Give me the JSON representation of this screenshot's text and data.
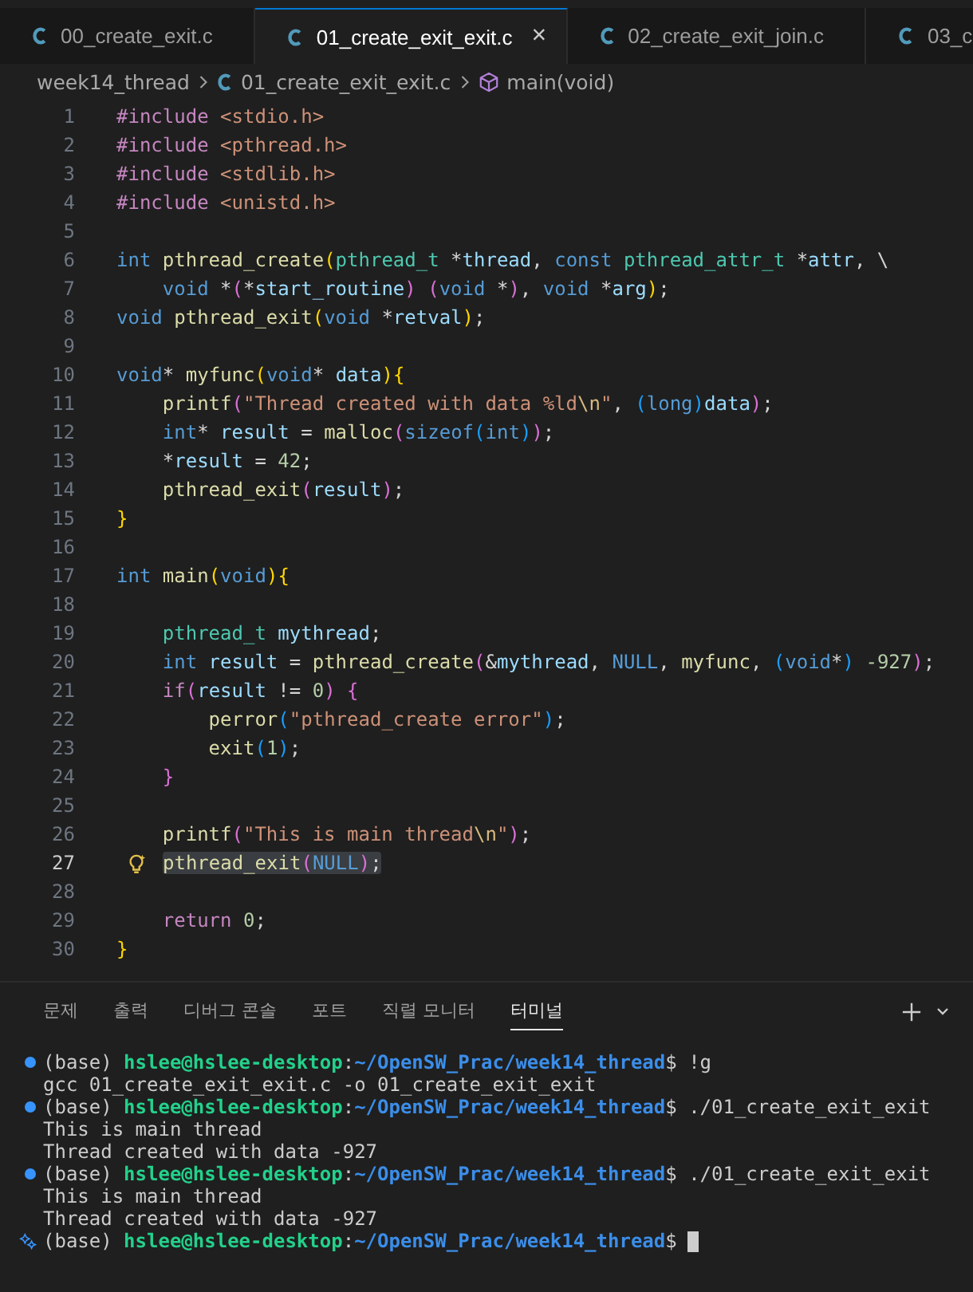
{
  "tabs": [
    {
      "label": "00_create_exit.c",
      "selected": false
    },
    {
      "label": "01_create_exit_exit.c",
      "selected": true,
      "close": "×"
    },
    {
      "label": "02_create_exit_join.c",
      "selected": false
    },
    {
      "label": "03_c",
      "selected": false
    }
  ],
  "breadcrumb": {
    "folder": "week14_thread",
    "file": "01_create_exit_exit.c",
    "symbol": "main(void)"
  },
  "code": [
    {
      "number": "1",
      "current": false,
      "tokens": [
        {
          "kind": "pre",
          "text": "#include"
        },
        {
          "kind": "hdr",
          "text": " <stdio.h>"
        }
      ]
    },
    {
      "number": "2",
      "current": false,
      "tokens": [
        {
          "kind": "pre",
          "text": "#include"
        },
        {
          "kind": "hdr",
          "text": " <pthread.h>"
        }
      ]
    },
    {
      "number": "3",
      "current": false,
      "tokens": [
        {
          "kind": "pre",
          "text": "#include"
        },
        {
          "kind": "hdr",
          "text": " <stdlib.h>"
        }
      ]
    },
    {
      "number": "4",
      "current": false,
      "tokens": [
        {
          "kind": "pre",
          "text": "#include"
        },
        {
          "kind": "hdr",
          "text": " <unistd.h>"
        }
      ]
    },
    {
      "number": "5",
      "current": false
    },
    {
      "number": "6",
      "current": false,
      "tokens": [
        {
          "kind": "kw",
          "text": "int"
        },
        {
          "kind": "fn",
          "text": " pthread_create"
        },
        {
          "kind": "b1",
          "text": "("
        },
        {
          "kind": "type",
          "text": "pthread_t"
        },
        {
          "kind": "p",
          "text": " *"
        },
        {
          "kind": "var",
          "text": "thread"
        },
        {
          "kind": "p",
          "text": ", "
        },
        {
          "kind": "kw",
          "text": "const"
        },
        {
          "kind": "type",
          "text": " pthread_attr_t"
        },
        {
          "kind": "p",
          "text": " *"
        },
        {
          "kind": "var",
          "text": "attr"
        },
        {
          "kind": "p",
          "text": ", \\"
        }
      ]
    },
    {
      "number": "7",
      "current": false,
      "tokens": [
        {
          "kind": "kw",
          "text": "    void"
        },
        {
          "kind": "p",
          "text": " *"
        },
        {
          "kind": "b2",
          "text": "("
        },
        {
          "kind": "p",
          "text": "*"
        },
        {
          "kind": "var",
          "text": "start_routine"
        },
        {
          "kind": "b2",
          "text": ")"
        },
        {
          "kind": "b2",
          "text": " ("
        },
        {
          "kind": "kw",
          "text": "void"
        },
        {
          "kind": "p",
          "text": " *"
        },
        {
          "kind": "b2",
          "text": ")"
        },
        {
          "kind": "p",
          "text": ","
        },
        {
          "kind": "kw",
          "text": " void"
        },
        {
          "kind": "p",
          "text": " *"
        },
        {
          "kind": "var",
          "text": "arg"
        },
        {
          "kind": "b1",
          "text": ")"
        },
        {
          "kind": "p",
          "text": ";"
        }
      ]
    },
    {
      "number": "8",
      "current": false,
      "tokens": [
        {
          "kind": "kw",
          "text": "void"
        },
        {
          "kind": "fn",
          "text": " pthread_exit"
        },
        {
          "kind": "b1",
          "text": "("
        },
        {
          "kind": "kw",
          "text": "void"
        },
        {
          "kind": "p",
          "text": " *"
        },
        {
          "kind": "var",
          "text": "retval"
        },
        {
          "kind": "b1",
          "text": ")"
        },
        {
          "kind": "p",
          "text": ";"
        }
      ]
    },
    {
      "number": "9",
      "current": false
    },
    {
      "number": "10",
      "current": false,
      "tokens": [
        {
          "kind": "kw",
          "text": "void"
        },
        {
          "kind": "p",
          "text": "*"
        },
        {
          "kind": "fn",
          "text": " myfunc"
        },
        {
          "kind": "b1",
          "text": "("
        },
        {
          "kind": "kw",
          "text": "void"
        },
        {
          "kind": "p",
          "text": "*"
        },
        {
          "kind": "var",
          "text": " data"
        },
        {
          "kind": "b1",
          "text": ")"
        },
        {
          "kind": "b1",
          "text": "{"
        }
      ]
    },
    {
      "number": "11",
      "current": false,
      "tokens": [
        {
          "kind": "fn",
          "text": "    printf"
        },
        {
          "kind": "b2",
          "text": "("
        },
        {
          "kind": "str",
          "text": "\"Thread created with data %ld"
        },
        {
          "kind": "esc",
          "text": "\\n"
        },
        {
          "kind": "str",
          "text": "\""
        },
        {
          "kind": "p",
          "text": ","
        },
        {
          "kind": "b3",
          "text": " ("
        },
        {
          "kind": "kw",
          "text": "long"
        },
        {
          "kind": "b3",
          "text": ")"
        },
        {
          "kind": "var",
          "text": "data"
        },
        {
          "kind": "b2",
          "text": ")"
        },
        {
          "kind": "p",
          "text": ";"
        }
      ]
    },
    {
      "number": "12",
      "current": false,
      "tokens": [
        {
          "kind": "kw",
          "text": "    int"
        },
        {
          "kind": "p",
          "text": "*"
        },
        {
          "kind": "var",
          "text": " result"
        },
        {
          "kind": "p",
          "text": " = "
        },
        {
          "kind": "fn",
          "text": "malloc"
        },
        {
          "kind": "b2",
          "text": "("
        },
        {
          "kind": "kw",
          "text": "sizeof"
        },
        {
          "kind": "b3",
          "text": "("
        },
        {
          "kind": "kw",
          "text": "int"
        },
        {
          "kind": "b3",
          "text": ")"
        },
        {
          "kind": "b2",
          "text": ")"
        },
        {
          "kind": "p",
          "text": ";"
        }
      ]
    },
    {
      "number": "13",
      "current": false,
      "tokens": [
        {
          "kind": "p",
          "text": "    *"
        },
        {
          "kind": "var",
          "text": "result"
        },
        {
          "kind": "p",
          "text": " = "
        },
        {
          "kind": "num",
          "text": "42"
        },
        {
          "kind": "p",
          "text": ";"
        }
      ]
    },
    {
      "number": "14",
      "current": false,
      "tokens": [
        {
          "kind": "fn",
          "text": "    pthread_exit"
        },
        {
          "kind": "b2",
          "text": "("
        },
        {
          "kind": "var",
          "text": "result"
        },
        {
          "kind": "b2",
          "text": ")"
        },
        {
          "kind": "p",
          "text": ";"
        }
      ]
    },
    {
      "number": "15",
      "current": false,
      "tokens": [
        {
          "kind": "b1",
          "text": "}"
        }
      ]
    },
    {
      "number": "16",
      "current": false
    },
    {
      "number": "17",
      "current": false,
      "tokens": [
        {
          "kind": "kw",
          "text": "int"
        },
        {
          "kind": "fn",
          "text": " main"
        },
        {
          "kind": "b1",
          "text": "("
        },
        {
          "kind": "kw",
          "text": "void"
        },
        {
          "kind": "b1",
          "text": ")"
        },
        {
          "kind": "b1",
          "text": "{"
        }
      ]
    },
    {
      "number": "18",
      "current": false
    },
    {
      "number": "19",
      "current": false,
      "tokens": [
        {
          "kind": "type",
          "text": "    pthread_t"
        },
        {
          "kind": "var",
          "text": " mythread"
        },
        {
          "kind": "p",
          "text": ";"
        }
      ]
    },
    {
      "number": "20",
      "current": false,
      "tokens": [
        {
          "kind": "kw",
          "text": "    int"
        },
        {
          "kind": "var",
          "text": " result"
        },
        {
          "kind": "p",
          "text": " = "
        },
        {
          "kind": "fn",
          "text": "pthread_create"
        },
        {
          "kind": "b2",
          "text": "("
        },
        {
          "kind": "p",
          "text": "&"
        },
        {
          "kind": "var",
          "text": "mythread"
        },
        {
          "kind": "p",
          "text": ","
        },
        {
          "kind": "kw",
          "text": " NULL"
        },
        {
          "kind": "p",
          "text": ","
        },
        {
          "kind": "fn",
          "text": " myfunc"
        },
        {
          "kind": "p",
          "text": ","
        },
        {
          "kind": "b3",
          "text": " ("
        },
        {
          "kind": "kw",
          "text": "void"
        },
        {
          "kind": "p",
          "text": "*"
        },
        {
          "kind": "b3",
          "text": ")"
        },
        {
          "kind": "num",
          "text": " -927"
        },
        {
          "kind": "b2",
          "text": ")"
        },
        {
          "kind": "p",
          "text": ";"
        }
      ]
    },
    {
      "number": "21",
      "current": false,
      "tokens": [
        {
          "kind": "ctl",
          "text": "    if"
        },
        {
          "kind": "b2",
          "text": "("
        },
        {
          "kind": "var",
          "text": "result"
        },
        {
          "kind": "p",
          "text": " != "
        },
        {
          "kind": "num",
          "text": "0"
        },
        {
          "kind": "b2",
          "text": ")"
        },
        {
          "kind": "b2",
          "text": " {"
        }
      ]
    },
    {
      "number": "22",
      "current": false,
      "tokens": [
        {
          "kind": "fn",
          "text": "        perror"
        },
        {
          "kind": "b3",
          "text": "("
        },
        {
          "kind": "str",
          "text": "\"pthread_create error\""
        },
        {
          "kind": "b3",
          "text": ")"
        },
        {
          "kind": "p",
          "text": ";"
        }
      ]
    },
    {
      "number": "23",
      "current": false,
      "tokens": [
        {
          "kind": "fn",
          "text": "        exit"
        },
        {
          "kind": "b3",
          "text": "("
        },
        {
          "kind": "num",
          "text": "1"
        },
        {
          "kind": "b3",
          "text": ")"
        },
        {
          "kind": "p",
          "text": ";"
        }
      ]
    },
    {
      "number": "24",
      "current": false,
      "tokens": [
        {
          "kind": "b2",
          "text": "    }"
        }
      ]
    },
    {
      "number": "25",
      "current": false
    },
    {
      "number": "26",
      "current": false,
      "tokens": [
        {
          "kind": "fn",
          "text": "    printf"
        },
        {
          "kind": "b2",
          "text": "("
        },
        {
          "kind": "str",
          "text": "\"This is main thread"
        },
        {
          "kind": "esc",
          "text": "\\n"
        },
        {
          "kind": "str",
          "text": "\""
        },
        {
          "kind": "b2",
          "text": ")"
        },
        {
          "kind": "p",
          "text": ";"
        }
      ]
    },
    {
      "number": "27",
      "current": true,
      "lightbulb": true,
      "marked": [
        {
          "kind": "fn",
          "text": "pthread_exit"
        },
        {
          "kind": "b2",
          "text": "("
        },
        {
          "kind": "kw",
          "text": "NULL"
        },
        {
          "kind": "b2",
          "text": ")"
        },
        {
          "kind": "p",
          "text": ";"
        }
      ]
    },
    {
      "number": "28",
      "current": false
    },
    {
      "number": "29",
      "current": false,
      "tokens": [
        {
          "kind": "ctl",
          "text": "    return"
        },
        {
          "kind": "num",
          "text": " 0"
        },
        {
          "kind": "p",
          "text": ";"
        }
      ]
    },
    {
      "number": "30",
      "current": false,
      "tokens": [
        {
          "kind": "b1",
          "text": "}"
        }
      ]
    }
  ],
  "panel_tabs": [
    {
      "label": "문제",
      "selected": false
    },
    {
      "label": "출력",
      "selected": false
    },
    {
      "label": "디버그 콘솔",
      "selected": false
    },
    {
      "label": "포트",
      "selected": false
    },
    {
      "label": "직렬 모니터",
      "selected": false
    },
    {
      "label": "터미널",
      "selected": true
    }
  ],
  "terminal": [
    {
      "kind": "prompt",
      "running": false,
      "env": "(base)",
      "user": "hslee@hslee-desktop",
      "sep": ":",
      "path": "~/OpenSW_Prac/week14_thread",
      "dollar": "$",
      "command": "!g",
      "cursor": false
    },
    {
      "kind": "output",
      "text": "gcc 01_create_exit_exit.c -o 01_create_exit_exit"
    },
    {
      "kind": "prompt",
      "running": false,
      "env": "(base)",
      "user": "hslee@hslee-desktop",
      "sep": ":",
      "path": "~/OpenSW_Prac/week14_thread",
      "dollar": "$",
      "command": "./01_create_exit_exit",
      "cursor": false
    },
    {
      "kind": "output",
      "text": "This is main thread"
    },
    {
      "kind": "output",
      "text": "Thread created with data -927"
    },
    {
      "kind": "prompt",
      "running": false,
      "env": "(base)",
      "user": "hslee@hslee-desktop",
      "sep": ":",
      "path": "~/OpenSW_Prac/week14_thread",
      "dollar": "$",
      "command": "./01_create_exit_exit",
      "cursor": false
    },
    {
      "kind": "output",
      "text": "This is main thread"
    },
    {
      "kind": "output",
      "text": "Thread created with data -927"
    },
    {
      "kind": "prompt",
      "running": true,
      "env": "(base)",
      "user": "hslee@hslee-desktop",
      "sep": ":",
      "path": "~/OpenSW_Prac/week14_thread",
      "dollar": "$",
      "cursor": true
    }
  ]
}
